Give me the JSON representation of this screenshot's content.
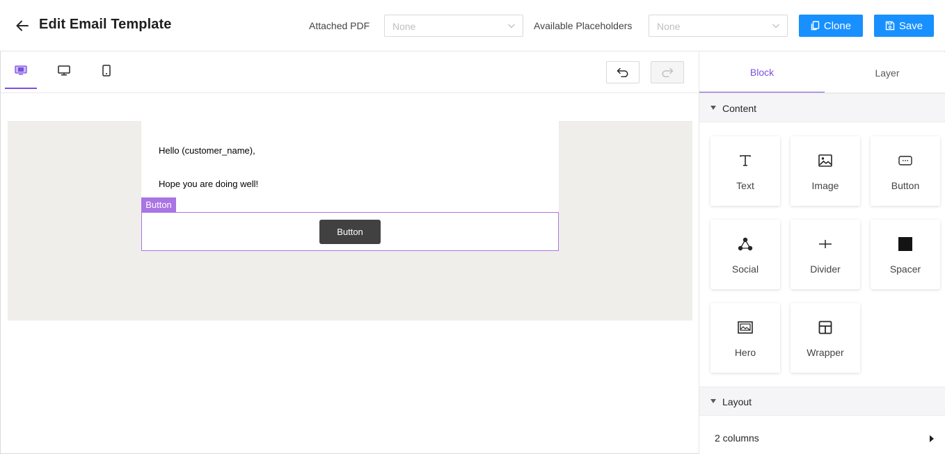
{
  "header": {
    "title": "Edit Email Template",
    "attached_pdf_label": "Attached PDF",
    "attached_pdf_value": "None",
    "placeholders_label": "Available Placeholders",
    "placeholders_value": "None",
    "clone_label": "Clone",
    "save_label": "Save"
  },
  "toolbar": {
    "device_tabs": [
      "responsive-view-icon",
      "desktop-icon",
      "mobile-icon"
    ],
    "active_device": "responsive"
  },
  "canvas": {
    "greeting": "Hello (customer_name),",
    "message": "Hope you are doing well!",
    "selected_block_label": "Button",
    "button_text": "Button"
  },
  "panel": {
    "tabs": [
      {
        "label": "Block",
        "active": true
      },
      {
        "label": "Layer",
        "active": false
      }
    ],
    "content_section": "Content",
    "blocks": [
      {
        "label": "Text",
        "icon": "text-icon"
      },
      {
        "label": "Image",
        "icon": "image-icon"
      },
      {
        "label": "Button",
        "icon": "button-icon"
      },
      {
        "label": "Social",
        "icon": "social-icon"
      },
      {
        "label": "Divider",
        "icon": "divider-icon"
      },
      {
        "label": "Spacer",
        "icon": "spacer-icon"
      },
      {
        "label": "Hero",
        "icon": "hero-icon"
      },
      {
        "label": "Wrapper",
        "icon": "wrapper-icon"
      }
    ],
    "layout_section": "Layout",
    "layout_items": [
      {
        "label": "2 columns"
      }
    ]
  },
  "colors": {
    "primary": "#1890ff",
    "accent_purple": "#7b4fe0",
    "selection_purple": "#a974e3",
    "canvas_background": "#efeeeb",
    "email_button": "#414141"
  }
}
